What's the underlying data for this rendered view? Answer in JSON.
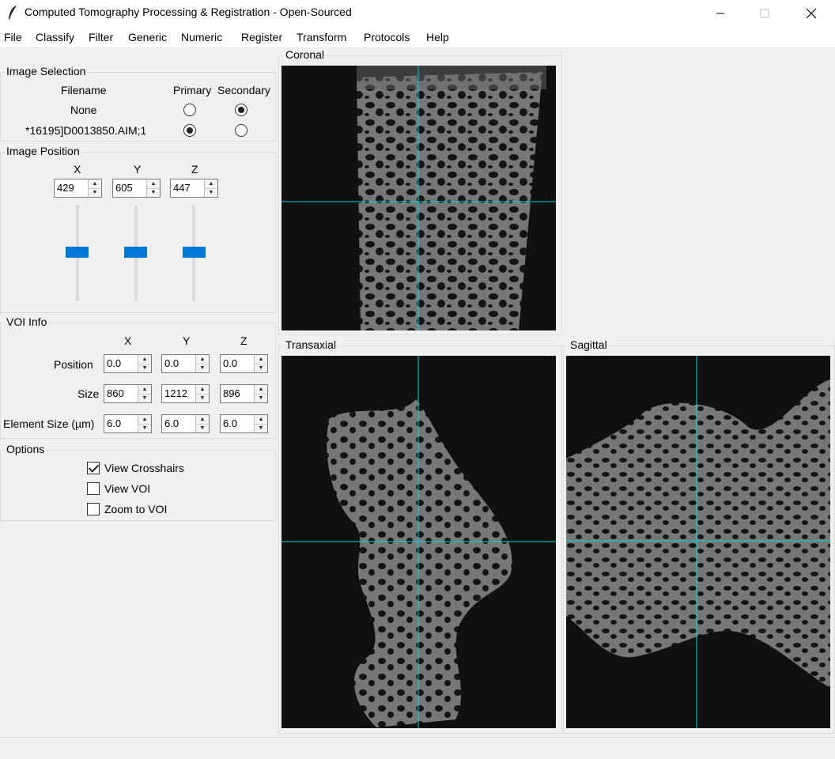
{
  "window": {
    "title": "Computed Tomography Processing & Registration - Open-Sourced"
  },
  "menu": [
    "File",
    "Classify",
    "Filter",
    "Generic",
    "Numeric",
    "Register",
    "Transform",
    "Protocols",
    "Help"
  ],
  "image_selection": {
    "label": "Image Selection",
    "col_filename": "Filename",
    "col_primary": "Primary",
    "col_secondary": "Secondary",
    "rows": [
      {
        "filename": "None",
        "primary": false,
        "secondary": true
      },
      {
        "filename": "*16195]D0013850.AIM;1",
        "primary": true,
        "secondary": false
      }
    ]
  },
  "image_position": {
    "label": "Image Position",
    "x_label": "X",
    "y_label": "Y",
    "z_label": "Z",
    "x": "429",
    "y": "605",
    "z": "447"
  },
  "voi_info": {
    "label": "VOI Info",
    "x_label": "X",
    "y_label": "Y",
    "z_label": "Z",
    "position_label": "Position",
    "size_label": "Size",
    "element_label": "Element Size (µm)",
    "position": [
      "0.0",
      "0.0",
      "0.0"
    ],
    "size": [
      "860",
      "1212",
      "896"
    ],
    "element": [
      "6.0",
      "6.0",
      "6.0"
    ]
  },
  "options": {
    "label": "Options",
    "view_crosshairs": "View Crosshairs",
    "view_voi": "View VOI",
    "zoom_to_voi": "Zoom to VOI",
    "crosshairs_checked": true,
    "voi_checked": false,
    "zoom_checked": false
  },
  "views": {
    "coronal": "Coronal",
    "transaxial": "Transaxial",
    "sagittal": "Sagittal"
  },
  "colors": {
    "crosshair": "#00d8d8",
    "slider_thumb": "#0078d7",
    "scan_background": "#101010",
    "bone": "#7a7a7a"
  }
}
